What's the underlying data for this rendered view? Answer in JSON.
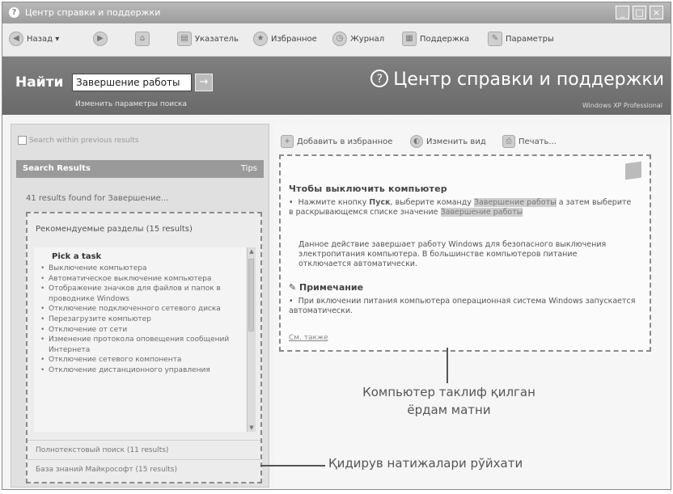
{
  "window": {
    "title": "Центр справки и поддержки",
    "app_icon": "?",
    "controls": [
      "_",
      "□",
      "×"
    ]
  },
  "toolbar": {
    "items": [
      {
        "label": "Назад",
        "icon": "back-arrow-icon"
      },
      {
        "label": "",
        "icon": "forward-arrow-icon"
      },
      {
        "label": "",
        "icon": "home-icon"
      },
      {
        "label": "Указатель",
        "icon": "index-book-icon"
      },
      {
        "label": "Избранное",
        "icon": "favorites-star-icon"
      },
      {
        "label": "Журнал",
        "icon": "history-clock-icon"
      },
      {
        "label": "Поддержка",
        "icon": "support-icon"
      },
      {
        "label": "Параметры",
        "icon": "options-icon"
      }
    ]
  },
  "header": {
    "find_label": "Найти",
    "search_value": "Завершение работы",
    "go_glyph": "→",
    "search_options": "Изменить параметры поиска",
    "center_title": "Центр справки и поддержки",
    "center_icon_glyph": "?",
    "edition": "Windows XP Professional"
  },
  "left": {
    "search_within": "Search within previous results",
    "results_header": "Search Results",
    "tips": "Tips",
    "results_count": "41 results found for Завершение...",
    "group1": "Рекомендуемые разделы (15 results)",
    "pick_title": "Pick a task",
    "tasks": [
      "Выключение компьютера",
      "Автоматическое выключение компьютера",
      "Отображение значков для файлов и папок в проводнике Windows",
      "Отключение подключенного сетевого диска",
      "Перезагрузите компьютер",
      "Отключение от сети",
      "Изменение протокола оповещения сообщений Интернета",
      "Отключение сетевого компонента",
      "Отключение дистанционного управления"
    ],
    "group2": "Полнотекстовый поиск (11 results)",
    "group3": "База знаний Майкрософт (15 results)"
  },
  "right": {
    "tools": {
      "add_favorites": "Добавить в избранное",
      "change_view": "Изменить вид",
      "print": "Печать..."
    },
    "article": {
      "title": "Чтобы выключить компьютер",
      "step_prefix": "Нажмите кнопку",
      "step_bold": "Пуск",
      "step_mid": ", выберите команду",
      "step_hl1": "Завершение работы",
      "step_cont": "а затем выберите в раскрывающемся списке значение",
      "step_hl2": "Завершение работы",
      "desc": "Данное действие завершает работу Windows для безопасного выключения электропитания компьютера. В большинстве компьютеров питание отключается автоматически.",
      "note_title": "Примечание",
      "note_text": "При включении питания компьютера операционная система Windows запускается автоматически.",
      "related": "См. также"
    }
  },
  "callouts": {
    "article_caption": "Компьютер таклиф қилган ёрдам матни",
    "results_caption": "Қидирув натижалари рўйхати"
  }
}
